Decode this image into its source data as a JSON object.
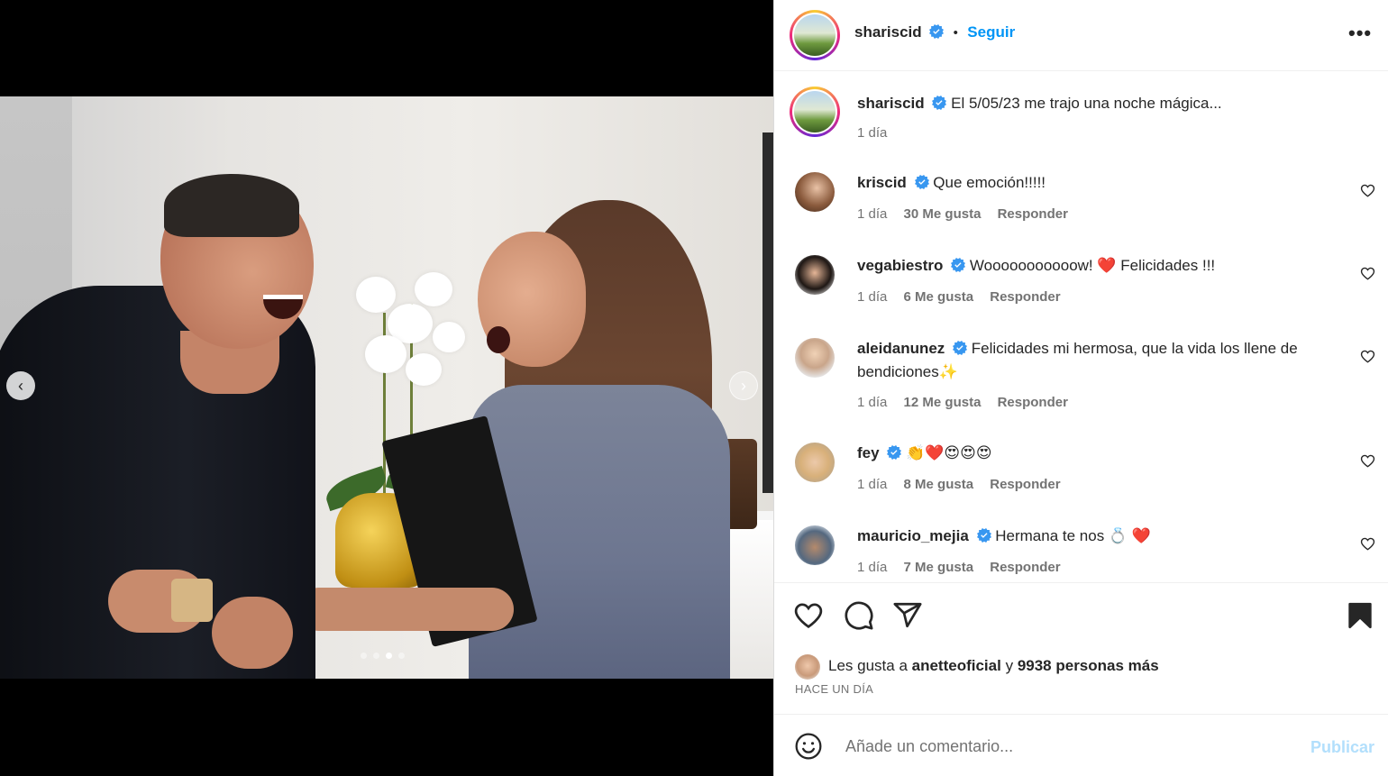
{
  "post": {
    "username": "shariscid",
    "follow_label": "Seguir",
    "separator": "•",
    "caption": "El 5/05/23 me trajo una noche mágica...",
    "caption_time": "1 día",
    "carousel": {
      "total_slides": 4,
      "active_index": 2
    }
  },
  "comments": [
    {
      "username": "kriscid",
      "text": "Que emoción!!!!!",
      "time": "1 día",
      "likes": "30 Me gusta",
      "reply": "Responder"
    },
    {
      "username": "vegabiestro",
      "text": "Wooooooooooow! ❤️ Felicidades !!!",
      "time": "1 día",
      "likes": "6 Me gusta",
      "reply": "Responder"
    },
    {
      "username": "aleidanunez",
      "text": "Felicidades mi hermosa, que la vida los llene de bendiciones✨",
      "time": "1 día",
      "likes": "12 Me gusta",
      "reply": "Responder"
    },
    {
      "username": "fey",
      "text": "👏❤️😍😍😍",
      "time": "1 día",
      "likes": "8 Me gusta",
      "reply": "Responder"
    },
    {
      "username": "mauricio_mejia",
      "text": "Hermana te nos 💍 ❤️",
      "time": "1 día",
      "likes": "7 Me gusta",
      "reply": "Responder"
    }
  ],
  "likes": {
    "prefix": "Les gusta a",
    "user": "anetteoficial",
    "joiner": "y",
    "others": "9938 personas más",
    "timestamp": "HACE UN DÍA"
  },
  "composer": {
    "placeholder": "Añade un comentario...",
    "publish_label": "Publicar"
  },
  "icons": {
    "actions": [
      "heart-icon",
      "comment-icon",
      "share-icon",
      "bookmark-icon"
    ],
    "verified": "verified-badge-icon",
    "more": "more-options-icon",
    "emoji": "emoji-icon",
    "carousel_prev": "chevron-left-icon",
    "carousel_next": "chevron-right-icon"
  },
  "colors": {
    "accent": "#0095f6",
    "verified": "#3897f0",
    "publish_disabled": "#b2dffc",
    "muted": "#737373"
  }
}
